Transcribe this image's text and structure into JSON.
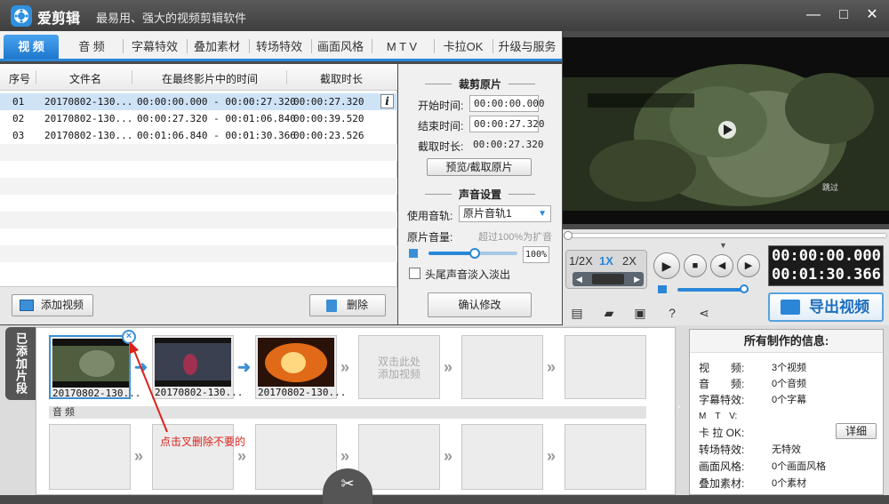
{
  "app": {
    "name": "爱剪辑",
    "slogan": "最易用、强大的视频剪辑软件"
  },
  "window_controls": [
    "—",
    "□",
    "✕"
  ],
  "tabs": [
    "视 频",
    "音 频",
    "字幕特效",
    "叠加素材",
    "转场特效",
    "画面风格",
    "M T V",
    "卡拉OK",
    "升级与服务"
  ],
  "list": {
    "headers": [
      "序号",
      "文件名",
      "在最终影片中的时间",
      "截取时长"
    ],
    "rows": [
      {
        "no": "01",
        "file": "20170802-130...",
        "time": "00:00:00.000 - 00:00:27.320",
        "dur": "00:00:27.320"
      },
      {
        "no": "02",
        "file": "20170802-130...",
        "time": "00:00:27.320 - 00:01:06.840",
        "dur": "00:00:39.520"
      },
      {
        "no": "03",
        "file": "20170802-130...",
        "time": "00:01:06.840 - 00:01:30.366",
        "dur": "00:00:23.526"
      }
    ],
    "add_label": "添加视频",
    "delete_label": "删除"
  },
  "trim": {
    "title": "裁剪原片",
    "start_label": "开始时间:",
    "start_value": "00:00:00.000",
    "end_label": "结束时间:",
    "end_value": "00:00:27.320",
    "dur_label": "截取时长:",
    "dur_value": "00:00:27.320",
    "preview_btn": "预览/截取原片",
    "sound_title": "声音设置",
    "track_label": "使用音轨:",
    "track_value": "原片音轨1",
    "vol_label": "原片音量:",
    "vol_hint": "超过100%为扩音",
    "vol_value": "100%",
    "fade_label": "头尾声音淡入淡出",
    "confirm_btn": "确认修改"
  },
  "player": {
    "speeds": [
      "1/2X",
      "1X",
      "2X"
    ],
    "time_current": "00:00:00.000",
    "time_total": "00:01:30.366",
    "export_label": "导出视频",
    "preview_skip": "跳过"
  },
  "timeline": {
    "side_label": "已添加片段",
    "clips": [
      {
        "cap": "20170802-130..."
      },
      {
        "cap": "20170802-130..."
      },
      {
        "cap": "20170802-130..."
      }
    ],
    "placeholder": [
      "双击此处",
      "添加视频"
    ],
    "audio_label": "音 频",
    "annotation": "点击叉删除不要的"
  },
  "info": {
    "title": "所有制作的信息:",
    "rows": [
      {
        "k": "视　　频:",
        "v": "3个视频"
      },
      {
        "k": "音　　频:",
        "v": "0个音频"
      },
      {
        "k": "字幕特效:",
        "v": "0个字幕"
      },
      {
        "k": "M　T　V:",
        "v": ""
      },
      {
        "k": "卡 拉 OK:",
        "v": ""
      },
      {
        "k": "转场特效:",
        "v": "无特效"
      },
      {
        "k": "画面风格:",
        "v": "0个画面风格"
      },
      {
        "k": "叠加素材:",
        "v": "0个素材"
      }
    ],
    "detail_btn": "详细"
  },
  "colors": {
    "accent": "#2b86d8",
    "annotation": "#d8221c"
  }
}
